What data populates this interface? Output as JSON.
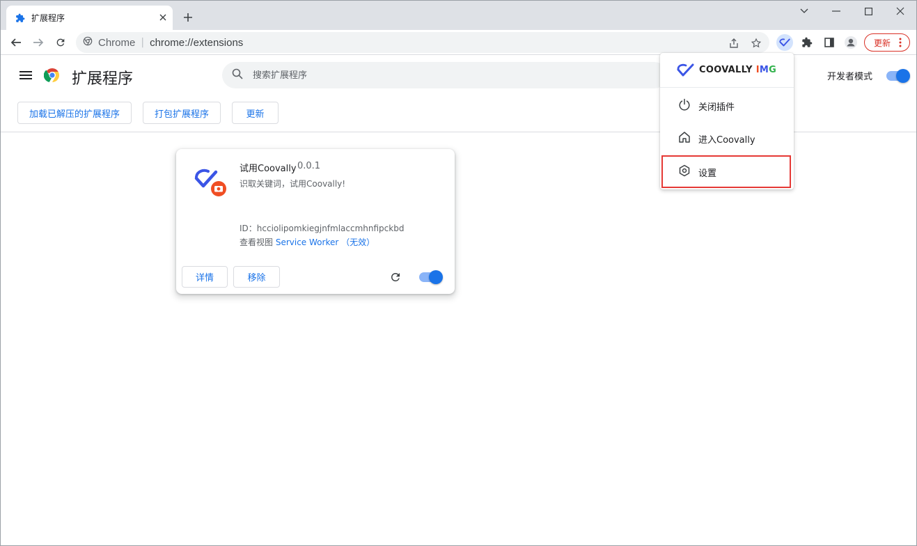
{
  "window": {
    "tab_title": "扩展程序",
    "controls": [
      "minimize",
      "maximize",
      "close"
    ],
    "menu_glyph": "∨"
  },
  "toolbar": {
    "omnibox_site": "Chrome",
    "omnibox_separator": "|",
    "omnibox_url": "chrome://extensions",
    "update_label": "更新"
  },
  "extensions_page": {
    "title": "扩展程序",
    "search_placeholder": "搜索扩展程序",
    "developer_mode_label": "开发者模式",
    "developer_mode_on": true,
    "buttons": {
      "load_unpacked": "加载已解压的扩展程序",
      "pack": "打包扩展程序",
      "update": "更新"
    }
  },
  "extension_card": {
    "name": "试用Coovally",
    "version": "0.0.1",
    "description": "识取关键词，试用Coovally!",
    "id_label": "ID：",
    "id_value": "hcciolipomkiegjnfmlaccmhnfipckbd",
    "views_label": "查看视图",
    "views_link": "Service Worker",
    "views_status": "（无效）",
    "details_label": "详情",
    "remove_label": "移除",
    "enabled": true
  },
  "popup": {
    "logo_text": "COOVALLY",
    "logo_suffix_i": "I",
    "logo_suffix_m": "M",
    "logo_suffix_g": "G",
    "items": [
      {
        "label": "关闭插件",
        "icon": "power-icon"
      },
      {
        "label": "进入Coovally",
        "icon": "home-icon"
      },
      {
        "label": "设置",
        "icon": "settings-icon"
      }
    ],
    "highlight_color": "#e53935"
  },
  "colors": {
    "accent": "#1a73e8",
    "update_red": "#d93025"
  }
}
